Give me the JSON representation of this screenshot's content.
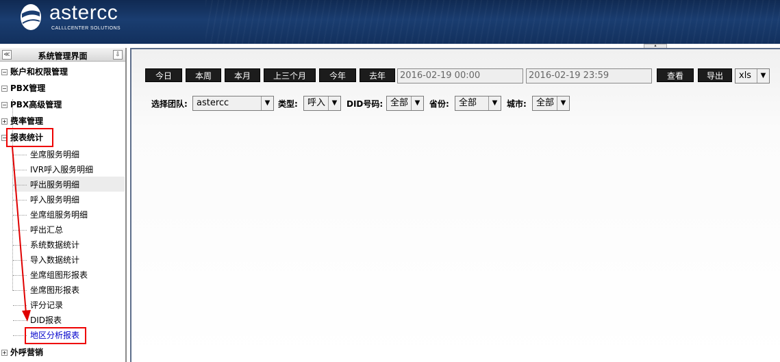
{
  "header": {
    "logo_text": "astercc",
    "logo_sub": "CALLLCENTER SOLUTIONS"
  },
  "sidebar": {
    "title": "系统管理界面",
    "collapse_glyph": "≪",
    "pin_glyph": "⇩",
    "sections": [
      {
        "label": "账户和权限管理",
        "toggle": "−"
      },
      {
        "label": "PBX管理",
        "toggle": "−"
      },
      {
        "label": "PBX高级管理",
        "toggle": "−"
      },
      {
        "label": "费率管理",
        "toggle": "+"
      },
      {
        "label": "报表统计",
        "toggle": "−"
      },
      {
        "label": "外呼营销",
        "toggle": "+"
      }
    ],
    "report_items": [
      "坐席服务明细",
      "IVR呼入服务明细",
      "呼出服务明细",
      "呼入服务明细",
      "坐席组服务明细",
      "呼出汇总",
      "系统数据统计",
      "导入数据统计",
      "坐席组图形报表",
      "坐席图形报表",
      "评分记录",
      "DID报表",
      "地区分析报表"
    ],
    "active_color": "#0000cc",
    "annotation_color": "#e00000"
  },
  "toolbar": {
    "ranges": [
      "今日",
      "本周",
      "本月",
      "上三个月",
      "今年",
      "去年"
    ],
    "start_date": "2016-02-19 00:00",
    "end_date": "2016-02-19 23:59",
    "view_label": "查看",
    "export_label": "导出",
    "export_format": "xls"
  },
  "filters": {
    "team_label": "选择团队:",
    "team_value": "astercc",
    "type_label": "类型:",
    "type_value": "呼入",
    "did_label": "DID号码:",
    "did_value": "全部",
    "province_label": "省份:",
    "province_value": "全部",
    "city_label": "城市:",
    "city_value": "全部"
  }
}
